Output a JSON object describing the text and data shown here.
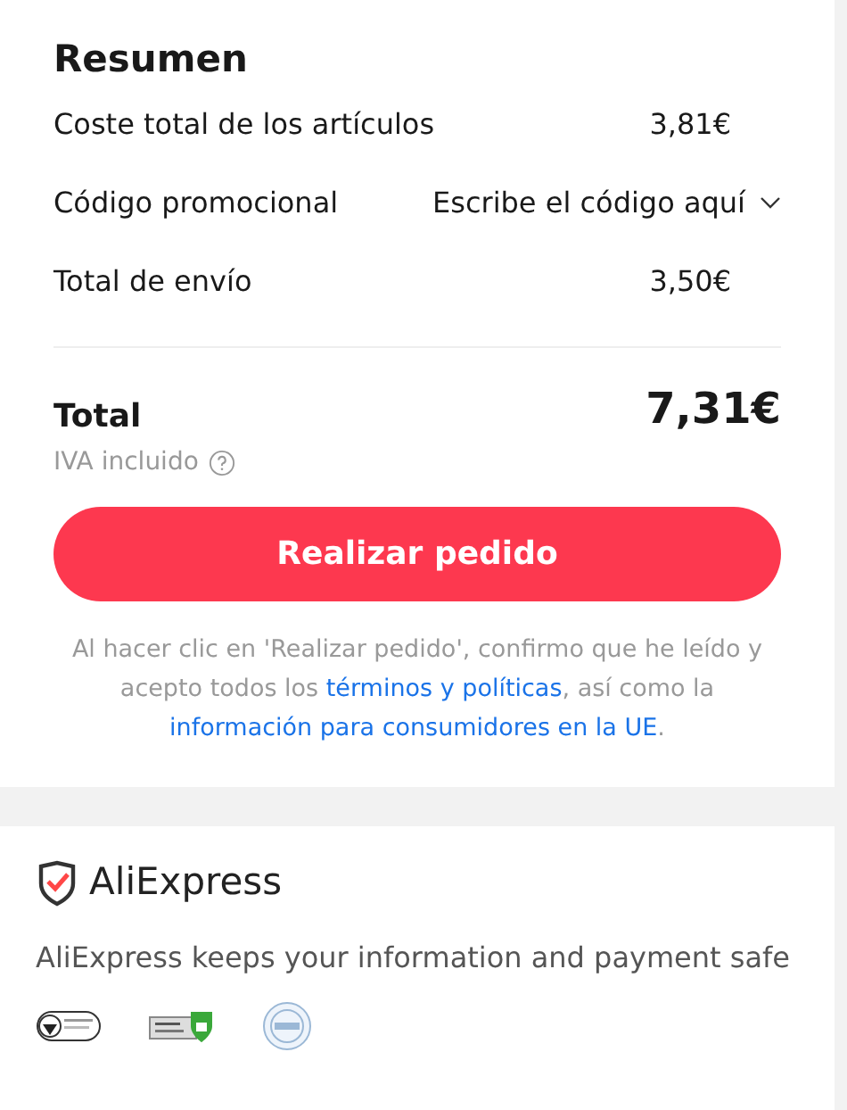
{
  "summary": {
    "title": "Resumen",
    "rows": [
      {
        "kind": "amount",
        "label": "Coste total de los artículos",
        "value": "3,81€"
      },
      {
        "kind": "promo",
        "label": "Código promocional",
        "placeholder": "Escribe el código aquí",
        "expanded": false
      },
      {
        "kind": "amount",
        "label": "Total de envío",
        "value": "3,50€"
      }
    ],
    "total": {
      "label": "Total",
      "value": "7,31€",
      "note": "IVA incluido"
    },
    "button": "Realizar pedido",
    "terms": {
      "before": "Al hacer clic en 'Realizar pedido', confirmo que he leído y acepto todos los",
      "link_1": "términos y políticas",
      "middle": ", así como la",
      "link_2": "información para consumidores en la UE",
      "after": "."
    }
  },
  "footer": {
    "brand": "AliExpress",
    "message": "AliExpress keeps your information and payment safe"
  }
}
